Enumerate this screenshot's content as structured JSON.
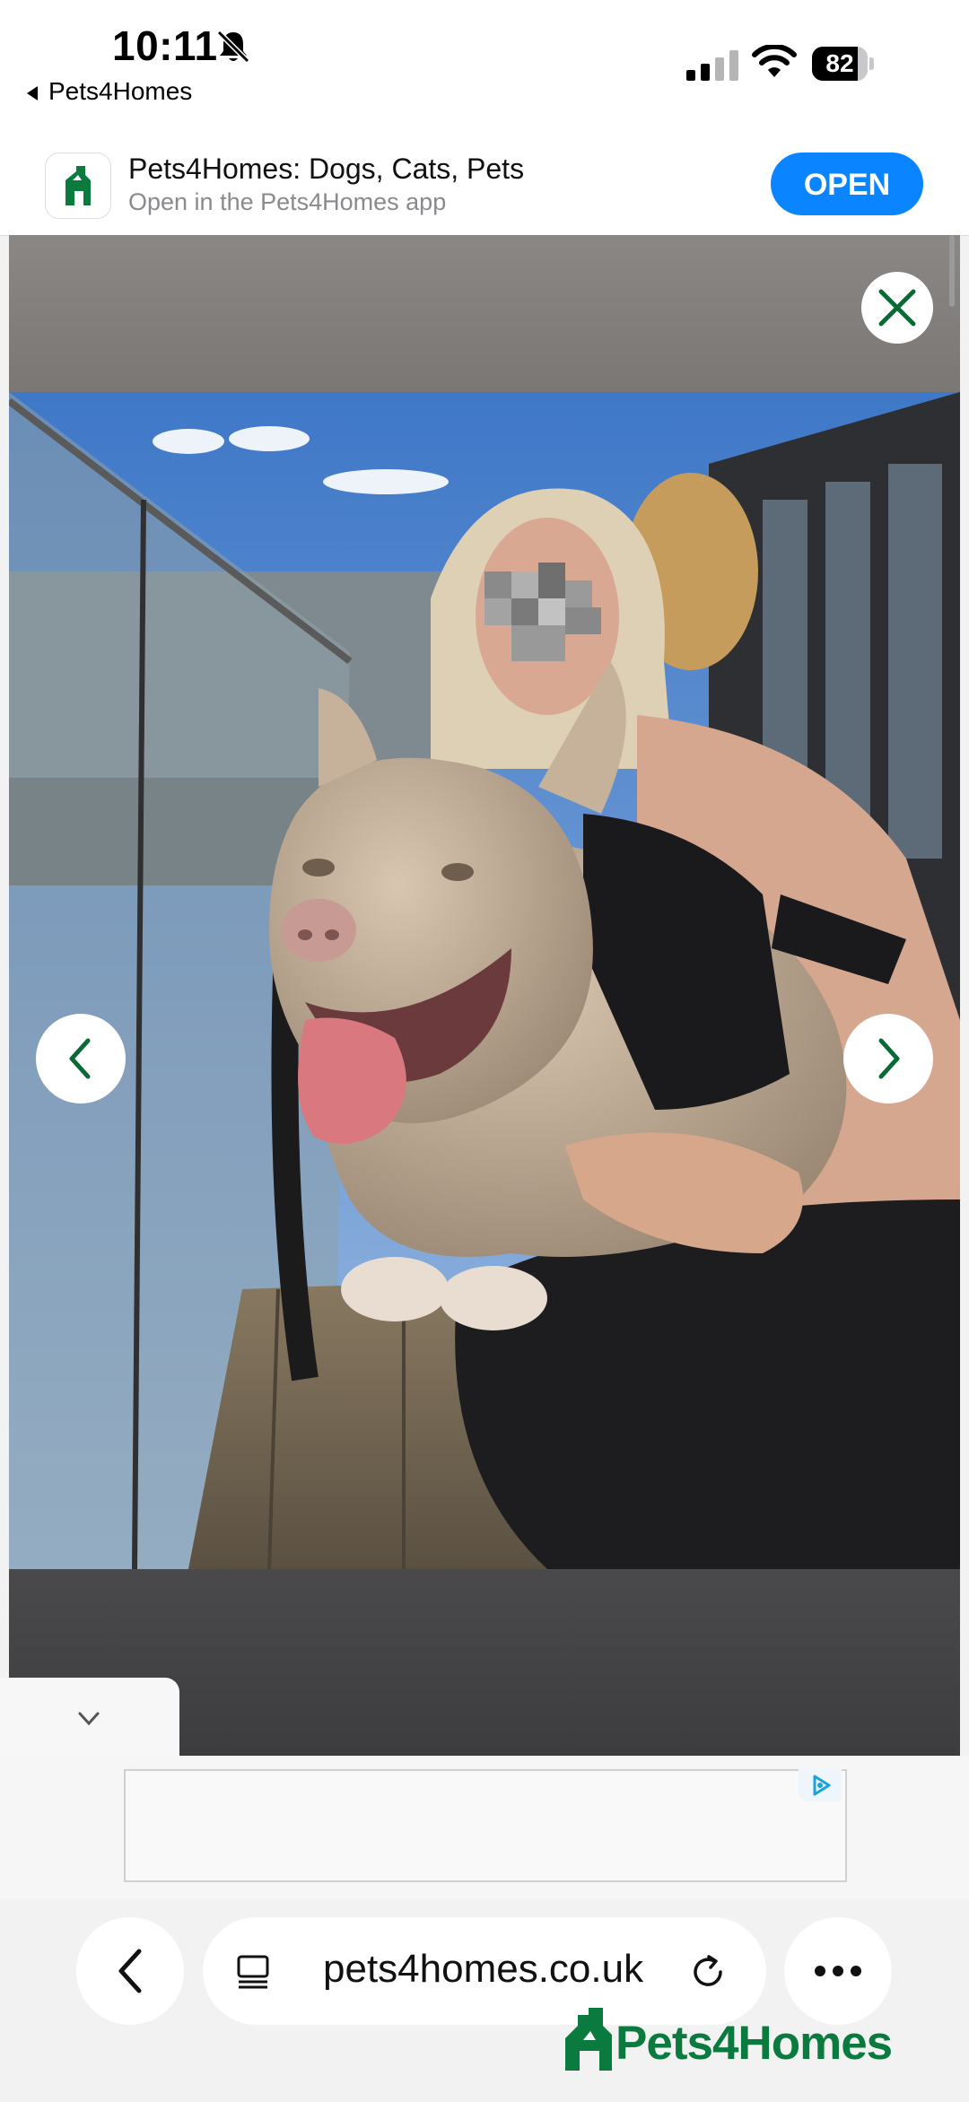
{
  "status_bar": {
    "time": "10:11",
    "back_app": "Pets4Homes",
    "battery": "82",
    "battery_level": 0.82
  },
  "app_banner": {
    "title": "Pets4Homes: Dogs, Cats, Pets",
    "subtitle": "Open in the Pets4Homes app",
    "open_label": "OPEN"
  },
  "gallery": {
    "photo_icon": "dog-photo-icon",
    "close_icon": "close-icon",
    "prev_icon": "chevron-left-icon",
    "next_icon": "chevron-right-icon"
  },
  "collapse": {
    "icon": "chevron-down-icon"
  },
  "ad": {
    "icon": "ad-choices-icon"
  },
  "toolbar": {
    "url": "pets4homes.co.uk",
    "back_icon": "chevron-left-icon",
    "tabs_icon": "page-icon",
    "reload_icon": "reload-icon",
    "more_icon": "more-icon"
  },
  "brand": {
    "name": "Pets4Homes"
  },
  "colors": {
    "accent": "#0a84ff",
    "brand_green": "#0a7a3e"
  }
}
